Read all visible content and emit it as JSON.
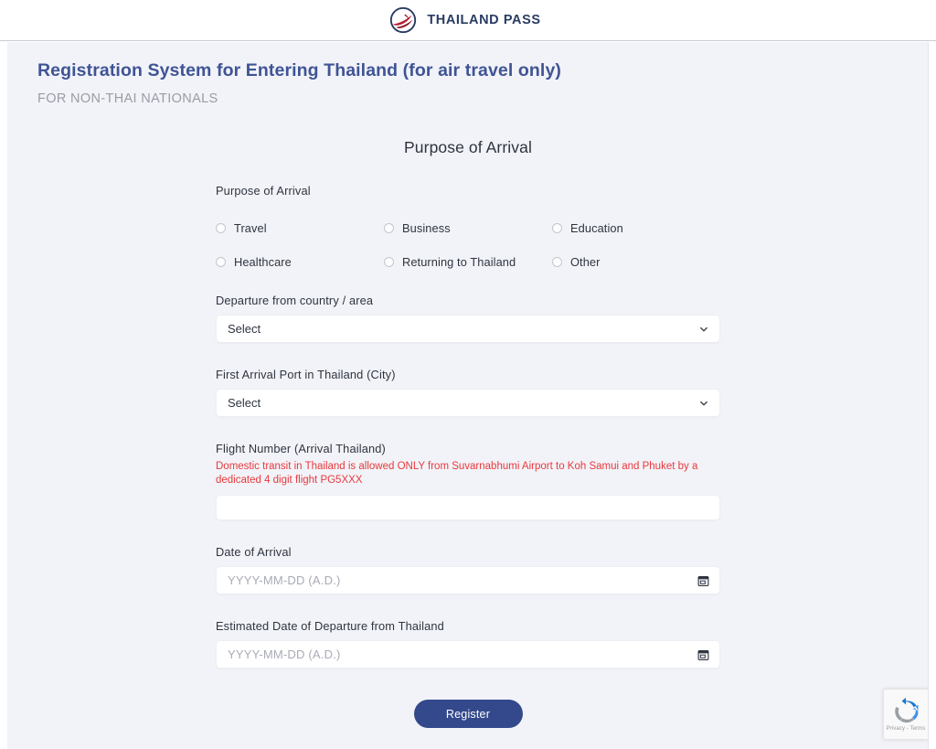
{
  "header": {
    "logo_icon": "thailand-pass-bird-logo",
    "logo_text": "THAILAND PASS"
  },
  "page": {
    "heading": "Registration System for Entering Thailand (for air travel only)",
    "subheading": "FOR NON-THAI NATIONALS",
    "section_title": "Purpose of Arrival"
  },
  "form": {
    "purpose": {
      "label": "Purpose of Arrival",
      "options": [
        {
          "label": "Travel",
          "selected": false
        },
        {
          "label": "Business",
          "selected": false
        },
        {
          "label": "Education",
          "selected": false
        },
        {
          "label": "Healthcare",
          "selected": false
        },
        {
          "label": "Returning to Thailand",
          "selected": false
        },
        {
          "label": "Other",
          "selected": false
        }
      ]
    },
    "departure_country": {
      "label": "Departure from country / area",
      "value": "Select",
      "icon": "chevron-down-icon"
    },
    "arrival_port": {
      "label": "First Arrival Port in Thailand (City)",
      "value": "Select",
      "icon": "chevron-down-icon"
    },
    "flight_number": {
      "label": "Flight Number (Arrival Thailand)",
      "warning": "Domestic transit in Thailand is allowed ONLY from Suvarnabhumi Airport to Koh Samui and Phuket by a dedicated 4 digit flight PG5XXX",
      "value": ""
    },
    "date_of_arrival": {
      "label": "Date of Arrival",
      "placeholder": "YYYY-MM-DD (A.D.)",
      "value": "",
      "icon": "calendar-icon"
    },
    "date_of_departure": {
      "label": "Estimated Date of Departure from Thailand",
      "placeholder": "YYYY-MM-DD (A.D.)",
      "value": "",
      "icon": "calendar-icon"
    },
    "submit_label": "Register"
  },
  "recaptcha": {
    "icon": "recaptcha-logo",
    "text": "Privacy - Terms"
  },
  "colors": {
    "page_background": "#f2f3f8",
    "heading": "#3f5495",
    "subheading": "#9a9ca6",
    "label": "#2e3440",
    "warning": "#e8393c",
    "button": "#33498c",
    "logo_navy": "#2a3b63",
    "logo_red": "#b32033"
  }
}
